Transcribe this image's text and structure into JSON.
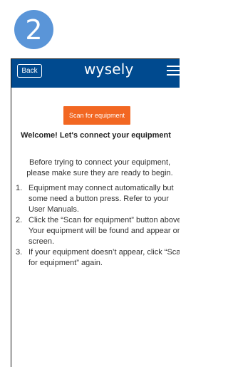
{
  "step_badge": "2",
  "navbar": {
    "back_label": "Back",
    "brand": "wysely",
    "menu_icon": "hamburger-menu-icon",
    "background_color": "#004a8f"
  },
  "scan_button_label": "Scan for equipment",
  "scan_button_color": "#f26722",
  "title": "Welcome! Let's connect your equipment",
  "intro": "Before trying to connect your equipment, please make sure they are ready to begin.",
  "steps": [
    {
      "num": "1.",
      "text": "Equipment may connect automatically but some need a button press. Refer to your User Manuals."
    },
    {
      "num": "2.",
      "text": "Click the “Scan for equipment” button above. Your equipment will be found and appear on screen."
    },
    {
      "num": "3.",
      "text": "If your equipment doesn’t appear, click “Scan for equipment” again."
    }
  ]
}
